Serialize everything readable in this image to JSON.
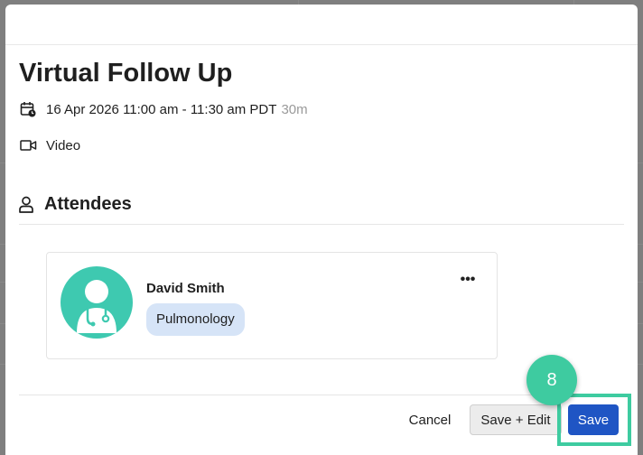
{
  "event": {
    "title": "Virtual Follow Up",
    "datetime": "16 Apr 2026 11:00 am - 11:30 am PDT",
    "duration": "30m",
    "location_type": "Video",
    "icons": {
      "date": "calendar-clock-icon",
      "video": "video-camera-icon"
    }
  },
  "attendees": {
    "heading": "Attendees",
    "icon": "person-icon",
    "items": [
      {
        "name": "David Smith",
        "specialty": "Pulmonology",
        "avatar_icon": "doctor-stethoscope-icon",
        "menu_icon": "more-horizontal-icon",
        "menu_label": "•••"
      }
    ]
  },
  "footer": {
    "cancel_label": "Cancel",
    "save_edit_label": "Save + Edit",
    "save_label": "Save"
  },
  "annotation": {
    "step_number": "8",
    "color": "#3ecba0"
  },
  "colors": {
    "primary": "#1f55c4",
    "avatar": "#3ec9b0",
    "badge_bg": "#d6e4f7"
  }
}
